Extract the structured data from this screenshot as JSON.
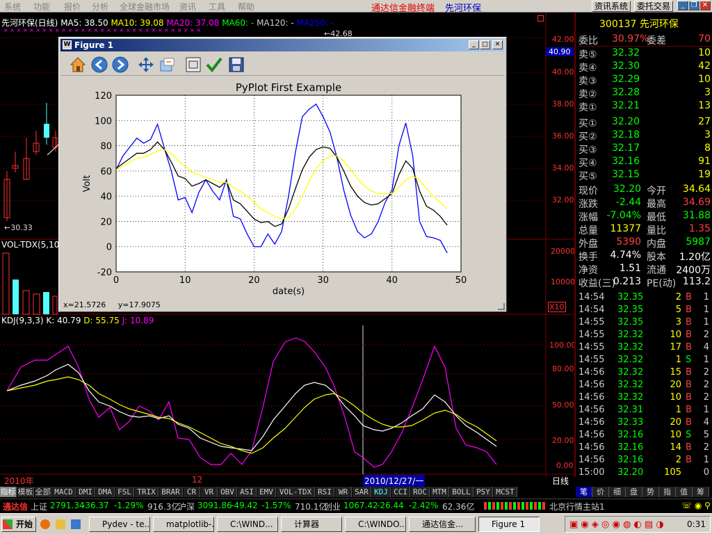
{
  "menu": [
    "系统",
    "功能",
    "报价",
    "分析",
    "全球金融市场",
    "资讯",
    "工具",
    "帮助"
  ],
  "app_title": "通达信金融终端",
  "app_stock": "先河环保",
  "top_buttons": {
    "info": "资讯系统",
    "trade": "委托交易"
  },
  "chart_header": {
    "name": "先河环保(日线)",
    "ma5": "MA5: 38.50",
    "ma10": "MA10: 39.08",
    "ma20": "MA20: 37.08",
    "ma60": "MA60: -",
    "ma120": "MA120: -",
    "ma250": "MA250: -"
  },
  "price_labels": [
    "42.00",
    "40.90",
    "40.00",
    "38.00",
    "36.00",
    "34.00",
    "32.00"
  ],
  "high_marker": "42.68",
  "low_marker": "30.33",
  "vol_header": "VOL-TDX(5,10)",
  "vol_labels": [
    "20000",
    "10000",
    "X10"
  ],
  "kdj_header": {
    "name": "KDJ(9,3,3)",
    "k": "K: 40.79",
    "d": "D: 55.75",
    "j": "J: 10.89"
  },
  "kdj_labels": [
    "100.00",
    "80.00",
    "50.00",
    "20.00",
    "0.00"
  ],
  "date_labels": {
    "left": "2010年",
    "mid": "12",
    "cursor": "2010/12/27/一",
    "period": "日线"
  },
  "figure": {
    "title": "Figure 1",
    "status_x": "x=21.5726",
    "status_y": "y=17.9075",
    "icons": [
      "home-icon",
      "back-icon",
      "forward-icon",
      "pan-icon",
      "zoom-icon",
      "configure-subplots-icon",
      "check-icon",
      "save-icon"
    ]
  },
  "chart_data": {
    "type": "line",
    "title": "PyPlot First Example",
    "xlabel": "date(s)",
    "ylabel": "Volt",
    "xlim": [
      0,
      50
    ],
    "ylim": [
      -20,
      120
    ],
    "xticks": [
      0,
      10,
      20,
      30,
      40,
      50
    ],
    "yticks": [
      -20,
      0,
      20,
      40,
      60,
      80,
      100,
      120
    ],
    "grid": true,
    "x": [
      0,
      1,
      2,
      3,
      4,
      5,
      6,
      7,
      8,
      9,
      10,
      11,
      12,
      13,
      14,
      15,
      16,
      17,
      18,
      19,
      20,
      21,
      22,
      23,
      24,
      25,
      26,
      27,
      28,
      29,
      30,
      31,
      32,
      33,
      34,
      35,
      36,
      37,
      38,
      39,
      40,
      41,
      42,
      43,
      44,
      45,
      46,
      47,
      48
    ],
    "series": [
      {
        "color": "#0000ff",
        "values": [
          61,
          72,
          79,
          86,
          82,
          85,
          97,
          78,
          60,
          37,
          39,
          27,
          43,
          53,
          44,
          37,
          53,
          24,
          22,
          10,
          0,
          0,
          10,
          2,
          12,
          40,
          75,
          103,
          109,
          113,
          103,
          91,
          71,
          45,
          25,
          12,
          7,
          10,
          20,
          35,
          45,
          80,
          98,
          72,
          20,
          8,
          7,
          5,
          -5
        ]
      },
      {
        "color": "#000000",
        "values": [
          62,
          66,
          70,
          74,
          74,
          77,
          83,
          77,
          67,
          56,
          54,
          48,
          50,
          53,
          50,
          47,
          52,
          37,
          34,
          28,
          22,
          19,
          20,
          16,
          18,
          30,
          46,
          61,
          71,
          77,
          79,
          78,
          71,
          60,
          48,
          40,
          35,
          33,
          34,
          38,
          42,
          57,
          68,
          62,
          44,
          32,
          29,
          24,
          17
        ]
      },
      {
        "color": "#ffff00",
        "values": [
          61,
          64,
          67,
          70,
          71,
          73,
          76,
          77,
          74,
          68,
          64,
          59,
          57,
          55,
          53,
          51,
          51,
          47,
          44,
          40,
          35,
          30,
          27,
          24,
          22,
          23,
          30,
          40,
          52,
          62,
          68,
          72,
          72,
          68,
          61,
          54,
          48,
          44,
          42,
          42,
          42,
          47,
          53,
          56,
          53,
          46,
          40,
          35,
          30
        ]
      }
    ]
  },
  "right_panel": {
    "code": "300137",
    "name": "先河环保",
    "weibi": {
      "label": "委比",
      "value": "30.97%",
      "diff_label": "委差",
      "diff": "70"
    },
    "sells": [
      {
        "label": "卖⑤",
        "price": "32.32",
        "vol": "10"
      },
      {
        "label": "卖④",
        "price": "32.30",
        "vol": "42"
      },
      {
        "label": "卖③",
        "price": "32.29",
        "vol": "10"
      },
      {
        "label": "卖②",
        "price": "32.28",
        "vol": "3"
      },
      {
        "label": "卖①",
        "price": "32.21",
        "vol": "13"
      }
    ],
    "buys": [
      {
        "label": "买①",
        "price": "32.20",
        "vol": "27"
      },
      {
        "label": "买②",
        "price": "32.18",
        "vol": "3"
      },
      {
        "label": "买③",
        "price": "32.17",
        "vol": "8"
      },
      {
        "label": "买④",
        "price": "32.16",
        "vol": "91"
      },
      {
        "label": "买⑤",
        "price": "32.15",
        "vol": "19"
      }
    ],
    "stats": [
      {
        "l1": "现价",
        "v1": "32.20",
        "l2": "今开",
        "v2": "34.64",
        "c1": "#00ff00",
        "c2": "#ffff00"
      },
      {
        "l1": "涨跌",
        "v1": "-2.44",
        "l2": "最高",
        "v2": "34.69",
        "c1": "#00ff00",
        "c2": "#ff4040"
      },
      {
        "l1": "涨幅",
        "v1": "-7.04%",
        "l2": "最低",
        "v2": "31.88",
        "c1": "#00ff00",
        "c2": "#00ff00"
      },
      {
        "l1": "总量",
        "v1": "11377",
        "l2": "量比",
        "v2": "1.35",
        "c1": "#ffff00",
        "c2": "#ff4040"
      },
      {
        "l1": "外盘",
        "v1": "5390",
        "l2": "内盘",
        "v2": "5987",
        "c1": "#ff4040",
        "c2": "#00ff00"
      },
      {
        "l1": "换手",
        "v1": "4.74%",
        "l2": "股本",
        "v2": "1.20亿",
        "c1": "#ffffff",
        "c2": "#ffffff"
      },
      {
        "l1": "净资",
        "v1": "1.51",
        "l2": "流通",
        "v2": "2400万",
        "c1": "#ffffff",
        "c2": "#ffffff"
      },
      {
        "l1": "收益(三)",
        "v1": "0.213",
        "l2": "PE(动)",
        "v2": "113.2",
        "c1": "#ffffff",
        "c2": "#ffffff"
      }
    ],
    "ticks": [
      {
        "t": "14:54",
        "p": "32.35",
        "v": "2",
        "f": "B",
        "n": "1"
      },
      {
        "t": "14:54",
        "p": "32.35",
        "v": "5",
        "f": "B",
        "n": "1"
      },
      {
        "t": "14:55",
        "p": "32.35",
        "v": "3",
        "f": "B",
        "n": "1"
      },
      {
        "t": "14:55",
        "p": "32.32",
        "v": "10",
        "f": "B",
        "n": "2"
      },
      {
        "t": "14:55",
        "p": "32.32",
        "v": "17",
        "f": "B",
        "n": "4"
      },
      {
        "t": "14:55",
        "p": "32.32",
        "v": "1",
        "f": "S",
        "n": "1"
      },
      {
        "t": "14:56",
        "p": "32.32",
        "v": "15",
        "f": "B",
        "n": "2"
      },
      {
        "t": "14:56",
        "p": "32.32",
        "v": "20",
        "f": "B",
        "n": "2"
      },
      {
        "t": "14:56",
        "p": "32.32",
        "v": "10",
        "f": "B",
        "n": "2"
      },
      {
        "t": "14:56",
        "p": "32.31",
        "v": "1",
        "f": "B",
        "n": "1"
      },
      {
        "t": "14:56",
        "p": "32.33",
        "v": "20",
        "f": "B",
        "n": "4"
      },
      {
        "t": "14:56",
        "p": "32.16",
        "v": "10",
        "f": "S",
        "n": "5"
      },
      {
        "t": "14:56",
        "p": "32.16",
        "v": "14",
        "f": "B",
        "n": "2"
      },
      {
        "t": "14:56",
        "p": "32.16",
        "v": "2",
        "f": "B",
        "n": "1"
      },
      {
        "t": "15:00",
        "p": "32.20",
        "v": "105",
        "f": "",
        "n": "0"
      }
    ],
    "bottom_tabs": [
      "笔",
      "价",
      "细",
      "盘",
      "势",
      "指",
      "值",
      "筹"
    ]
  },
  "bottom_tabs": [
    "指标",
    "模板",
    "全部",
    "MACD",
    "DMI",
    "DMA",
    "FSL",
    "TRIX",
    "BRAR",
    "CR",
    "VR",
    "OBV",
    "ASI",
    "EMV",
    "VOL-TDX",
    "RSI",
    "WR",
    "SAR",
    "KDJ",
    "CCI",
    "ROC",
    "MTM",
    "BOLL",
    "PSY",
    "MCST"
  ],
  "index_bar": {
    "brand": "通达信",
    "sh_label": "上证",
    "sh": "2791.34",
    "sh_chg": "-36.37",
    "sh_pct": "-1.29%",
    "sh_amt": "916.3亿",
    "sz_label": "沪深",
    "sz": "3091.86",
    "sz_chg": "-49.42",
    "sz_pct": "-1.57%",
    "sz_amt": "710.1亿",
    "cy_label": "创业",
    "cy": "1067.42",
    "cy_chg": "-26.44",
    "cy_pct": "-2.42%",
    "cy_amt": "62.36亿",
    "server": "北京行情主站1"
  },
  "taskbar": {
    "start": "开始",
    "tasks": [
      "Pydev - te...",
      "matplotlib-...",
      "C:\\WIND...",
      "计算器",
      "C:\\WINDO...",
      "通达信金...",
      "Figure 1"
    ],
    "clock": "0:31"
  }
}
